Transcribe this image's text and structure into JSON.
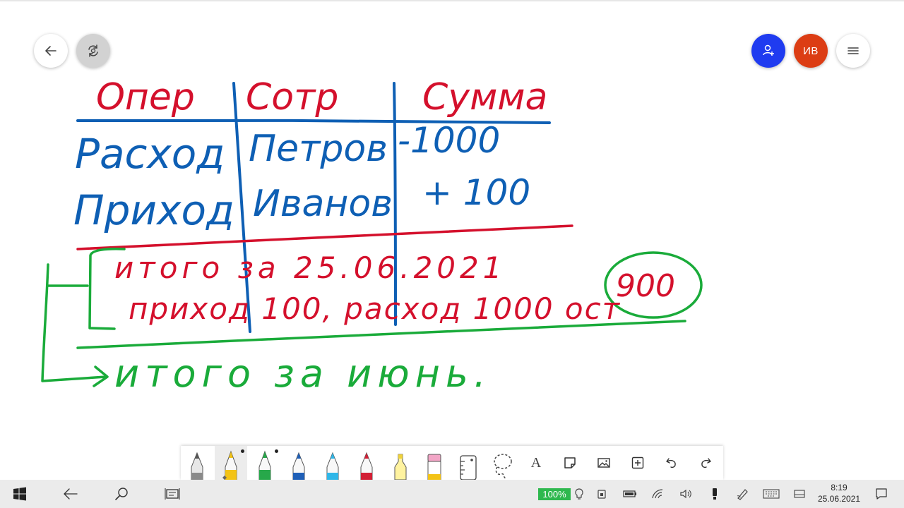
{
  "header": {
    "back_icon": "arrow-left-icon",
    "sync_icon": "sync-icon",
    "share_icon": "add-person-icon",
    "avatar_initials": "ИВ",
    "menu_icon": "hamburger-icon"
  },
  "whiteboard": {
    "colors": {
      "red": "#d4102c",
      "blue": "#0e5fb4",
      "green": "#1aab3a"
    },
    "headers": [
      "Опер",
      "Сотр",
      "Сумма"
    ],
    "rows": [
      [
        "Расход",
        "Петров",
        "-1000"
      ],
      [
        "Приход",
        "Иванов",
        "+ 100"
      ]
    ],
    "summary_line1": "итого за 25.06.2021",
    "summary_line2_text": "приход 100, расход 1000 ост",
    "summary_line2_circled": "900",
    "month_total": "итого за июнь."
  },
  "toolbar": {
    "tools": [
      {
        "name": "pencil-gray",
        "icon": "pencil-icon",
        "color": "#8a8a8a"
      },
      {
        "name": "pen-yellow",
        "icon": "pen-icon",
        "color": "#f3c316",
        "selected": true
      },
      {
        "name": "pen-green",
        "icon": "pen-icon",
        "color": "#27a84a"
      },
      {
        "name": "pen-blue",
        "icon": "pen-icon",
        "color": "#1f5fb7"
      },
      {
        "name": "pen-lightblue",
        "icon": "pen-icon",
        "color": "#2fb6e8"
      },
      {
        "name": "pen-red",
        "icon": "pen-icon",
        "color": "#d21f35"
      },
      {
        "name": "highlighter",
        "icon": "highlighter-icon",
        "color": "#fff3a0"
      },
      {
        "name": "eraser",
        "icon": "eraser-icon",
        "color": "#f2a5c6"
      },
      {
        "name": "ruler",
        "icon": "ruler-icon"
      },
      {
        "name": "lasso",
        "icon": "lasso-icon"
      },
      {
        "name": "text",
        "icon": "text-icon",
        "label": "A"
      },
      {
        "name": "sticky-note",
        "icon": "sticky-note-icon"
      },
      {
        "name": "image",
        "icon": "image-icon"
      },
      {
        "name": "add",
        "icon": "plus-box-icon"
      },
      {
        "name": "undo",
        "icon": "undo-icon"
      },
      {
        "name": "redo",
        "icon": "redo-icon"
      }
    ]
  },
  "taskbar": {
    "battery_percent": "100%",
    "time": "8:19",
    "date": "25.06.2021"
  }
}
